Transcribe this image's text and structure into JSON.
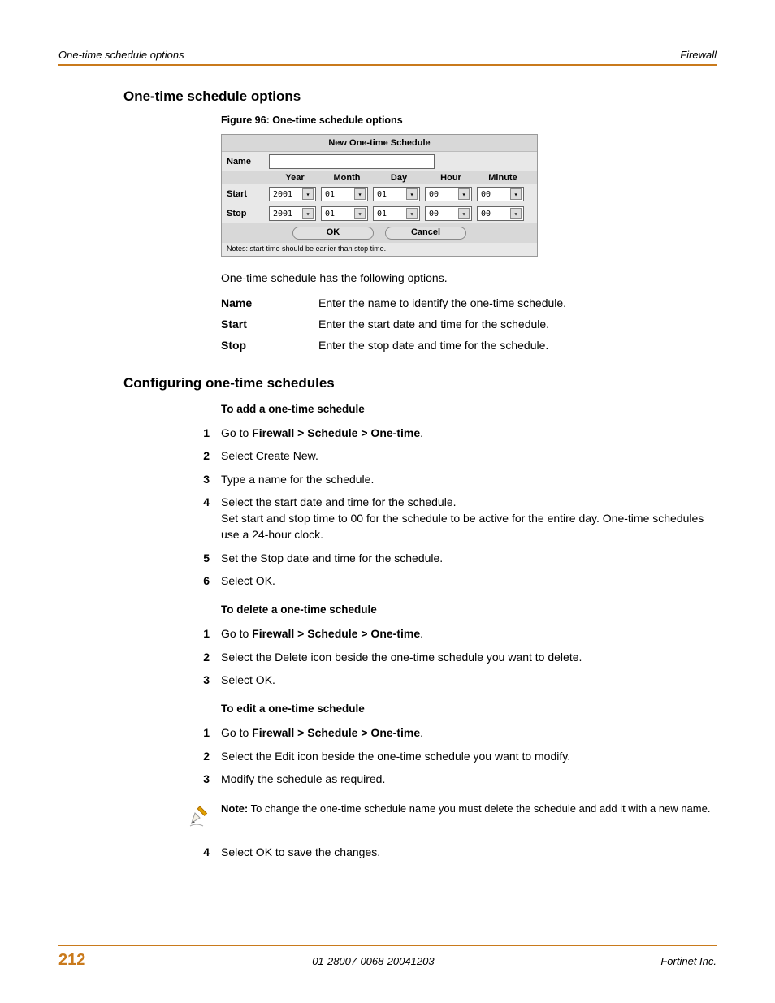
{
  "header": {
    "left": "One-time schedule options",
    "right": "Firewall"
  },
  "section1": {
    "title": "One-time schedule options",
    "figure_caption": "Figure 96: One-time schedule options",
    "figure": {
      "title": "New One-time Schedule",
      "name_label": "Name",
      "cols": [
        "Year",
        "Month",
        "Day",
        "Hour",
        "Minute"
      ],
      "start_label": "Start",
      "stop_label": "Stop",
      "start_vals": [
        "2001",
        "01",
        "01",
        "00",
        "00"
      ],
      "stop_vals": [
        "2001",
        "01",
        "01",
        "00",
        "00"
      ],
      "ok": "OK",
      "cancel": "Cancel",
      "note": "Notes: start time should be earlier than stop time."
    },
    "intro": "One-time schedule has the following options.",
    "defs": [
      {
        "term": "Name",
        "desc": "Enter the name to identify the one-time schedule."
      },
      {
        "term": "Start",
        "desc": "Enter the start date and time for the schedule."
      },
      {
        "term": "Stop",
        "desc": "Enter the stop date and time for the schedule."
      }
    ]
  },
  "section2": {
    "title": "Configuring one-time schedules",
    "proc1": {
      "title": "To add a one-time schedule",
      "steps": [
        {
          "n": "1",
          "pre": "Go to ",
          "bold": "Firewall > Schedule > One-time",
          "post": "."
        },
        {
          "n": "2",
          "text": "Select Create New."
        },
        {
          "n": "3",
          "text": "Type a name for the schedule."
        },
        {
          "n": "4",
          "text": "Select the start date and time for the schedule.",
          "text2": "Set start and stop time to 00 for the schedule to be active for the entire day. One-time schedules use a 24-hour clock."
        },
        {
          "n": "5",
          "text": "Set the Stop date and time for the schedule."
        },
        {
          "n": "6",
          "text": "Select OK."
        }
      ]
    },
    "proc2": {
      "title": "To delete a one-time schedule",
      "steps": [
        {
          "n": "1",
          "pre": "Go to ",
          "bold": "Firewall > Schedule > One-time",
          "post": "."
        },
        {
          "n": "2",
          "text": "Select the Delete icon beside the one-time schedule you want to delete."
        },
        {
          "n": "3",
          "text": "Select OK."
        }
      ]
    },
    "proc3": {
      "title": "To edit a one-time schedule",
      "steps": [
        {
          "n": "1",
          "pre": "Go to ",
          "bold": "Firewall > Schedule > One-time",
          "post": "."
        },
        {
          "n": "2",
          "text": "Select the Edit icon beside the one-time schedule you want to modify."
        },
        {
          "n": "3",
          "text": "Modify the schedule as required."
        }
      ]
    },
    "note": {
      "bold": "Note:",
      "text": " To change the one-time schedule name you must delete the schedule and add it with a new name."
    },
    "proc3b": {
      "steps": [
        {
          "n": "4",
          "text": "Select OK to save the changes."
        }
      ]
    }
  },
  "footer": {
    "page": "212",
    "center": "01-28007-0068-20041203",
    "right": "Fortinet Inc."
  }
}
